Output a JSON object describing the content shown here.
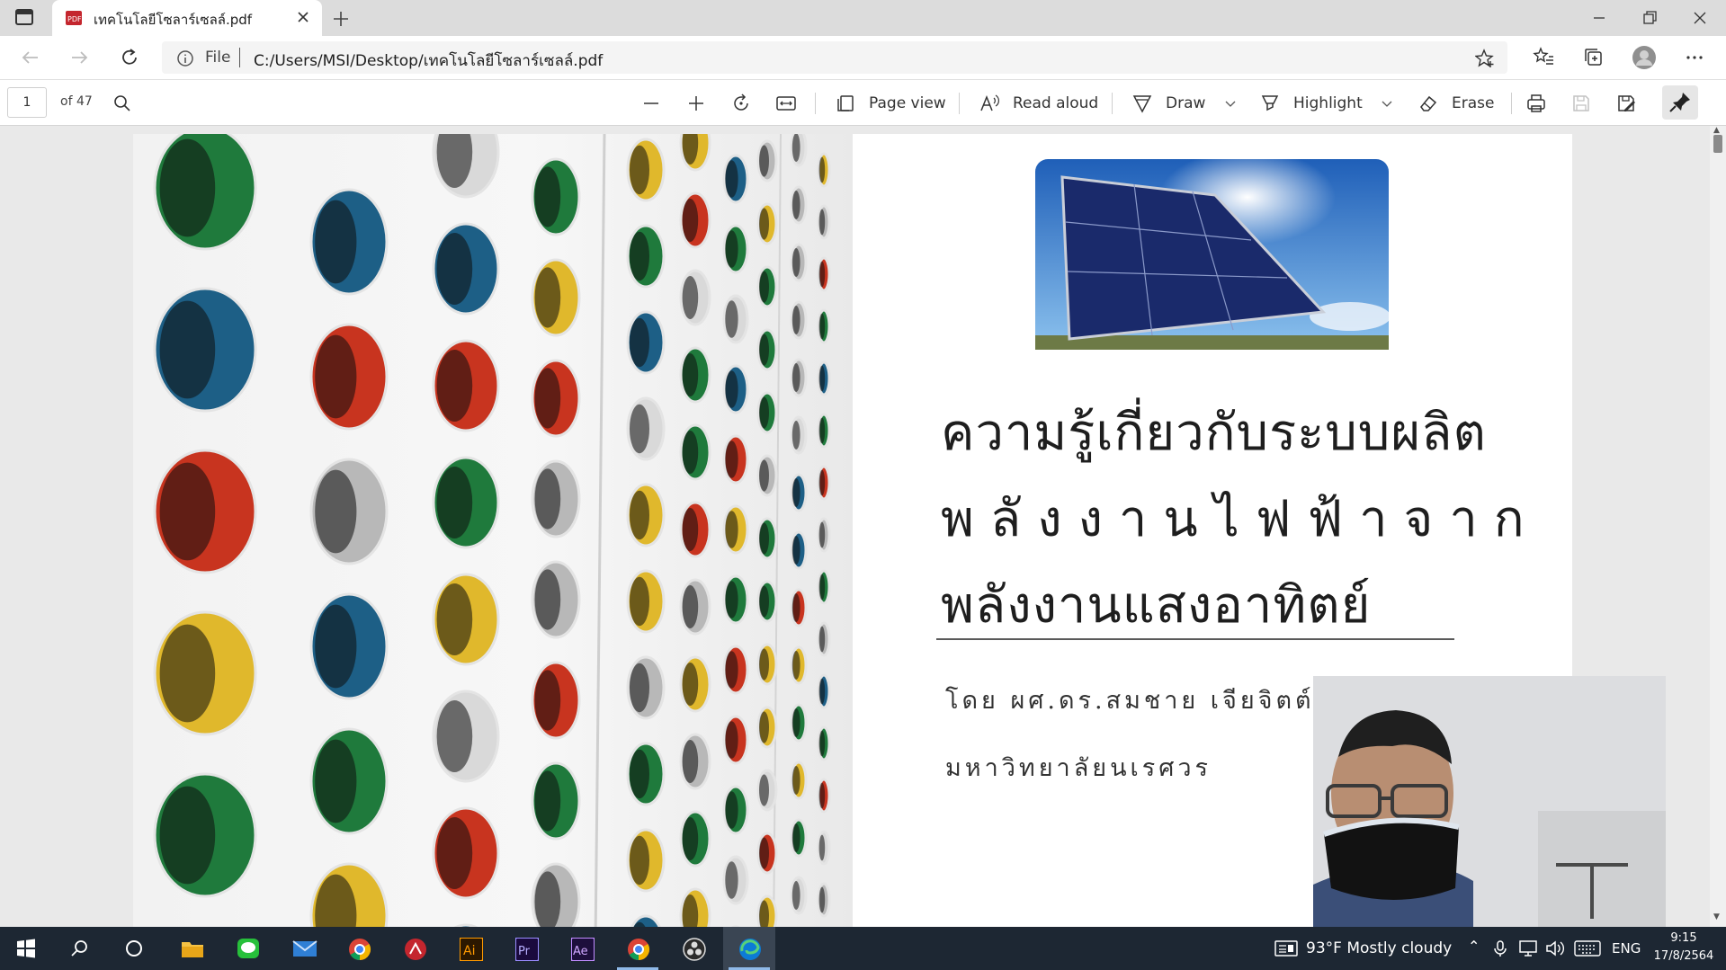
{
  "browser": {
    "tab_title": "เทคโนโลยีโซลาร์เซลล์.pdf",
    "address_scheme": "File",
    "address_url": "C:/Users/MSI/Desktop/เทคโนโลยีโซลาร์เซลล์.pdf"
  },
  "pdf_toolbar": {
    "page_number": "1",
    "page_total": "of 47",
    "page_view_label": "Page view",
    "read_aloud_label": "Read aloud",
    "draw_label": "Draw",
    "highlight_label": "Highlight",
    "erase_label": "Erase"
  },
  "document": {
    "title_line1": "ความรู้เกี่ยวกับระบบผลิต",
    "title_line2": "พลังงานไฟฟ้าจาก",
    "title_line3": "พลังงานแสงอาทิตย์",
    "author": "โดย ผศ.ดร.สมชาย เจียจิตต์สวั",
    "university": "มหาวิทยาลัยนเรศวร"
  },
  "taskbar": {
    "apps": [
      "start",
      "search",
      "cortana",
      "file-explorer",
      "line",
      "mail",
      "chrome",
      "acrobat",
      "illustrator",
      "premiere",
      "after-effects",
      "chrome-2",
      "obs",
      "edge"
    ],
    "weather": "93°F  Mostly cloudy",
    "language": "ENG",
    "time": "9:15",
    "date": "17/8/2564"
  },
  "colors": {
    "accent": "#0067c0",
    "taskbar": "#1d2733",
    "pdf_icon": "#c4262e"
  }
}
